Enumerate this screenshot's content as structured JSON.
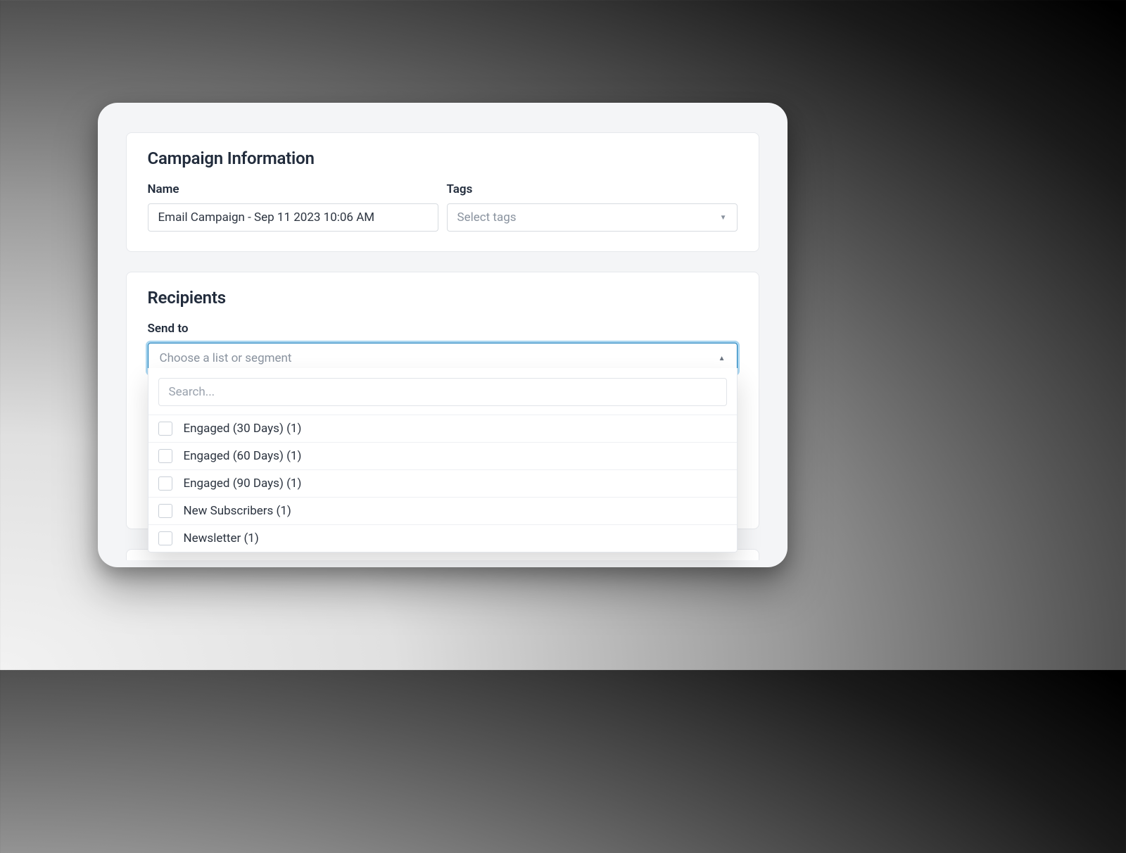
{
  "campaign": {
    "section_title": "Campaign Information",
    "name_label": "Name",
    "name_value": "Email Campaign - Sep 11 2023 10:06 AM",
    "tags_label": "Tags",
    "tags_placeholder": "Select tags"
  },
  "recipients": {
    "section_title": "Recipients",
    "sendto_label": "Send to",
    "sendto_placeholder": "Choose a list or segment",
    "search_placeholder": "Search...",
    "options": [
      {
        "label": "Engaged (30 Days) (1)"
      },
      {
        "label": "Engaged (60 Days) (1)"
      },
      {
        "label": "Engaged (90 Days) (1)"
      },
      {
        "label": "New Subscribers (1)"
      },
      {
        "label": "Newsletter (1)"
      }
    ]
  }
}
